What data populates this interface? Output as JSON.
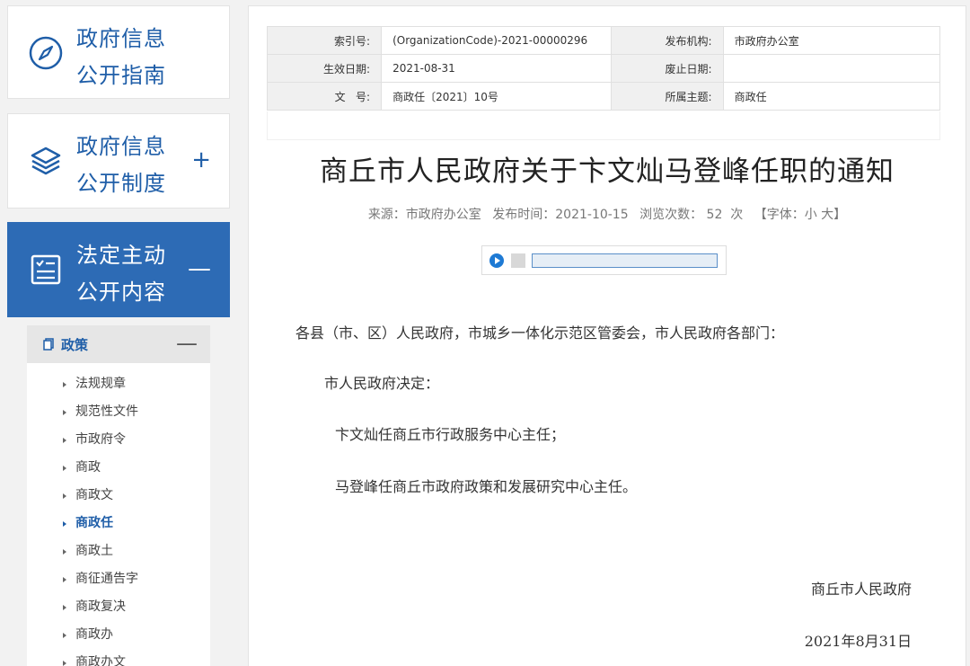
{
  "sidebar": {
    "cards": [
      {
        "title_line1": "政府信息",
        "title_line2": "公开指南",
        "icon": "compass-icon",
        "toggle": ""
      },
      {
        "title_line1": "政府信息",
        "title_line2": "公开制度",
        "icon": "layers-icon",
        "toggle": "+"
      },
      {
        "title_line1": "法定主动",
        "title_line2": "公开内容",
        "icon": "checklist-icon",
        "toggle": "—"
      }
    ],
    "subnav": {
      "head_label": "政策",
      "head_toggle": "—",
      "items": [
        {
          "label": "法规规章"
        },
        {
          "label": "规范性文件"
        },
        {
          "label": "市政府令"
        },
        {
          "label": "商政"
        },
        {
          "label": "商政文"
        },
        {
          "label": "商政任",
          "active": true
        },
        {
          "label": "商政土"
        },
        {
          "label": "商征通告字"
        },
        {
          "label": "商政复决"
        },
        {
          "label": "商政办"
        },
        {
          "label": "商政办文"
        }
      ]
    }
  },
  "meta": {
    "index_label": "索引号:",
    "index_value": "(OrganizationCode)-2021-00000296",
    "publisher_label": "发布机构:",
    "publisher_value": "市政府办公室",
    "effective_label": "生效日期:",
    "effective_value": "2021-08-31",
    "expire_label": "废止日期:",
    "expire_value": "",
    "docno_label": "文   号:",
    "docno_value": "商政任〔2021〕10号",
    "topic_label": "所属主题:",
    "topic_value": "商政任"
  },
  "article": {
    "title": "商丘市人民政府关于卞文灿马登峰任职的通知",
    "source": "来源：市政府办公室",
    "publish_time": "发布时间：2021-10-15",
    "views": "浏览次数： 52  次",
    "font_size": "【字体：小 大】",
    "p1": "各县（市、区）人民政府，市城乡一体化示范区管委会，市人民政府各部门：",
    "p2": "市人民政府决定：",
    "p3": "卞文灿任商丘市行政服务中心主任；",
    "p4": "马登峰任商丘市政府政策和发展研究中心主任。",
    "signature": "商丘市人民政府",
    "date": "2021年8月31日"
  },
  "colors": {
    "brand": "#2d6bb5",
    "accent_text": "#1f5ea8"
  }
}
